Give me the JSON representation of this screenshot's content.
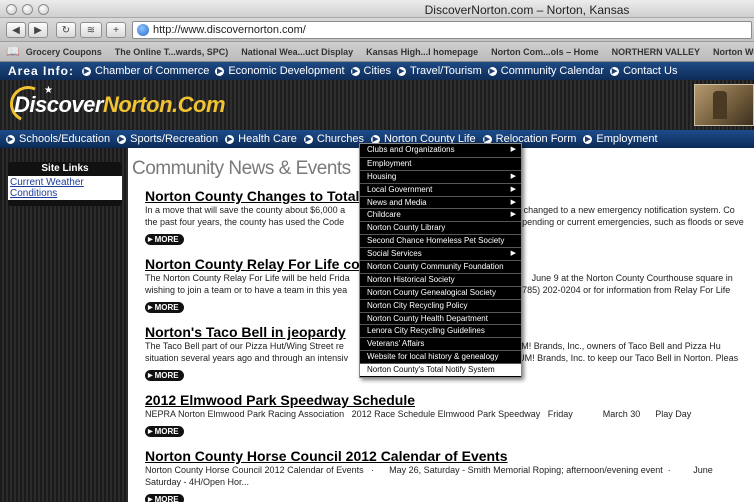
{
  "browser": {
    "window_title": "DiscoverNorton.com – Norton, Kansas",
    "url": "http://www.discovernorton.com/",
    "bookmarks": [
      "Grocery Coupons",
      "The Online T...wards, SPC)",
      "National Wea...uct Display",
      "Kansas High...l homepage",
      "Norton Com...ols – Home",
      "NORTHERN VALLEY",
      "Norton Weather"
    ]
  },
  "area": {
    "label": "Area Info:",
    "items": [
      "Chamber of Commerce",
      "Economic Development",
      "Cities",
      "Travel/Tourism",
      "Community Calendar",
      "Contact Us"
    ]
  },
  "logo": {
    "part1": "Discover",
    "part2": "Norton",
    "part3": ".Com"
  },
  "subnav": {
    "items": [
      "Schools/Education",
      "Sports/Recreation",
      "Health Care",
      "Churches",
      "Norton County Life",
      "Relocation Form",
      "Employment"
    ]
  },
  "sidebar": {
    "title": "Site Links",
    "links": [
      "Current Weather",
      "Conditions"
    ]
  },
  "main": {
    "section_title": "Community News & Events",
    "more_label": "MORE",
    "news": [
      {
        "title": "Norton County Changes to Total",
        "line1": "In a move that will save the county about $6,000 a",
        "line1b": "re changed to a new emergency notification system. Co",
        "line2": "the past four years, the county has used the Code",
        "line2b": "pending or current emergencies, such as floods or seve"
      },
      {
        "title": "Norton County Relay For Life co",
        "line1": "The Norton County Relay For Life will be held Frida",
        "line1b": "June 9 at the Norton County Courthouse square in",
        "line2": "wishing to join a team or to have a team in this yea",
        "line2b": "(785) 202-0204 or for information from Relay For Life"
      },
      {
        "title": "Norton's Taco Bell in jeopardy",
        "line1": "The Taco Bell part of our Pizza Hut/Wing Street re",
        "line1b": "ain. YUM! Brands, Inc., owners of Taco Bell and Pizza Hu",
        "line2": "situation several years ago and through an intensiv",
        "line2b": "UM! Brands, Inc. to keep our Taco Bell in Norton.  Pleas"
      },
      {
        "title": "2012 Elmwood Park Speedway Schedule",
        "line1": "NEPRA Norton Elmwood Park Racing Association   2012 Race Schedule Elmwood Park Speedway   Friday            March 30      Play Day",
        "line1b": "",
        "line2": "",
        "line2b": ""
      },
      {
        "title": "Norton County Horse Council 2012 Calendar of Events",
        "line1": "Norton County Horse Council 2012 Calendar of Events   ·      May 26, Saturday - Smith Memorial Roping; afternoon/evening event  ·         June",
        "line1b": "",
        "line2": "Saturday - 4H/Open Hor...",
        "line2b": ""
      }
    ]
  },
  "dropdown": {
    "items": [
      {
        "label": "Clubs and Organizations",
        "sub": true
      },
      {
        "label": "Employment",
        "sub": false
      },
      {
        "label": "Housing",
        "sub": true
      },
      {
        "label": "Local Government",
        "sub": true
      },
      {
        "label": "News and Media",
        "sub": true
      },
      {
        "label": "Childcare",
        "sub": true
      },
      {
        "label": "Norton County Library",
        "sub": false
      },
      {
        "label": "Second Chance Homeless Pet Society",
        "sub": false
      },
      {
        "label": "Social Services",
        "sub": true
      },
      {
        "label": "Norton County Community Foundation",
        "sub": false
      },
      {
        "label": "Norton Historical Society",
        "sub": false
      },
      {
        "label": "Norton County Genealogical Society",
        "sub": false
      },
      {
        "label": "Norton City Recycling Policy",
        "sub": false
      },
      {
        "label": "Norton County Health Department",
        "sub": false
      },
      {
        "label": "Lenora City Recycling Guidelines",
        "sub": false
      },
      {
        "label": "Veterans' Affairs",
        "sub": false
      },
      {
        "label": "Website for local history & genealogy",
        "sub": false
      },
      {
        "label": "Norton County's Total Notify System",
        "sub": false
      }
    ]
  }
}
